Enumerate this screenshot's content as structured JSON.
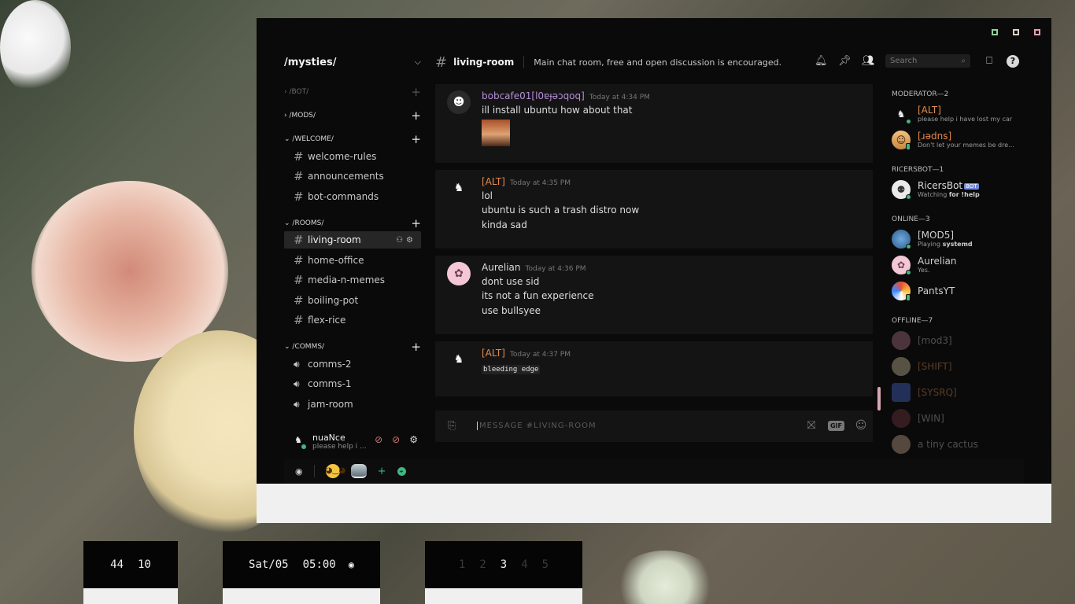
{
  "server": {
    "name": "/mysties/"
  },
  "categories": {
    "bot": "/BOT/",
    "mods": "/MODS/",
    "welcome": "/WELCOME/",
    "rooms": "/ROOMS/",
    "comms": "/COMMS/"
  },
  "channels": {
    "welcome": [
      "welcome-rules",
      "announcements",
      "bot-commands"
    ],
    "rooms": [
      "living-room",
      "home-office",
      "media-n-memes",
      "boiling-pot",
      "flex-rice"
    ],
    "voice": [
      "comms-2",
      "comms-1",
      "jam-room"
    ]
  },
  "user": {
    "name": "nuaNce",
    "status": "please help i ..."
  },
  "header": {
    "channel": "living-room",
    "topic": "Main chat room, free and open discussion is encouraged.",
    "search_placeholder": "Search"
  },
  "messages": [
    {
      "author": "bobcafe01[l0ɐɟǝɔqoq]",
      "author_color": "#b58fd6",
      "time": "Today at 4:34 PM",
      "lines": [
        "ill install ubuntu how about that"
      ]
    },
    {
      "author": "[ALT]",
      "author_color": "#e08a4f",
      "time": "Today at 4:35 PM",
      "lines": [
        "lol",
        "ubuntu is such a trash distro now",
        "kinda sad"
      ]
    },
    {
      "author": "Aurelian",
      "author_color": "#dcdcdc",
      "time": "Today at 4:36 PM",
      "lines": [
        "dont use sid",
        "its not a fun experience",
        "use bullsyee"
      ]
    },
    {
      "author": "[ALT]",
      "author_color": "#e08a4f",
      "time": "Today at 4:37 PM",
      "code": "bleeding edge"
    }
  ],
  "composer": {
    "placeholder": "MESSAGE #LIVING-ROOM"
  },
  "members": {
    "moderator_label": "MODERATOR—2",
    "moderators": [
      {
        "name": "[ALT]",
        "color": "#e08a4f",
        "status": "please help i have lost my car"
      },
      {
        "name": "[ɹǝdns]",
        "color": "#e08a4f",
        "status": "Don't let your memes be dre..."
      }
    ],
    "ricersbot_label": "RICERSBOT—1",
    "bot": {
      "name": "RicersBot",
      "tag": "BOT",
      "status_prefix": "Watching",
      "status_bold": "for !help"
    },
    "online_label": "ONLINE—3",
    "online": [
      {
        "name": "[MOD5]",
        "status_prefix": "Playing",
        "status_bold": "systemd"
      },
      {
        "name": "Aurelian",
        "status_prefix": "Yes.",
        "status_bold": ""
      },
      {
        "name": "PantsYT",
        "status_prefix": "",
        "status_bold": ""
      }
    ],
    "offline_label": "OFFLINE—7",
    "offline": [
      "[mod3]",
      "[SHIFT]",
      "[SYSRQ]",
      "[WIN]",
      "a tiny cactus"
    ]
  },
  "bar": {
    "clock_a": "44",
    "clock_b": "10",
    "date": "Sat/05",
    "time": "05:00",
    "workspaces": [
      "1",
      "2",
      "3",
      "4",
      "5"
    ],
    "current_workspace": "3"
  }
}
